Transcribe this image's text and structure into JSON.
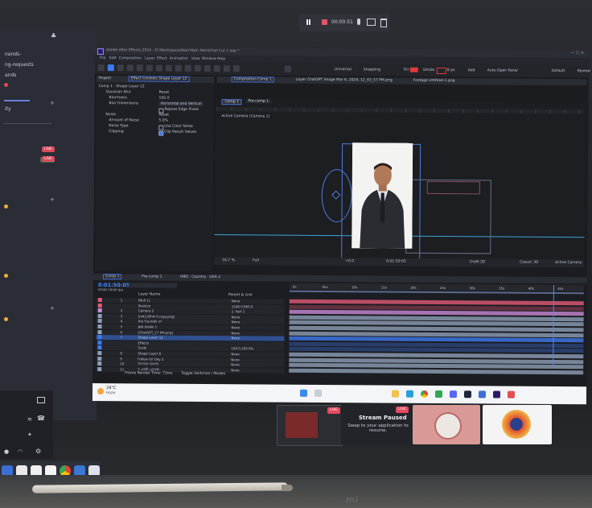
{
  "recording": {
    "time": "00:00:51"
  },
  "left_app": {
    "rows": [
      "nands-",
      "ng-requests",
      "ands",
      "ity"
    ],
    "live_label": "LIVE",
    "count_label": "23+23"
  },
  "ae": {
    "window_title": "Adobe After Effects 2024 - D:\\Workspace\\Reel Main Item\\Final Cut 1.aep *",
    "menu": [
      "File",
      "Edit",
      "Composition",
      "Layer",
      "Effect",
      "Animation",
      "View",
      "Window",
      "Help"
    ],
    "toolbar_options": [
      "Universal",
      "Snapping",
      "Fill",
      "Stroke",
      "8 px",
      "Add",
      "Auto-Open Panel",
      "Default",
      "Review"
    ],
    "project_tab": "Project",
    "effect_controls_tab": "Effect Controls Shape Layer 12",
    "effect_header": "Comp 1 · Shape Layer 12",
    "effects": [
      {
        "name": "Gaussian Blur",
        "value": "Reset"
      },
      {
        "name": "Blurriness",
        "value": "100.0"
      },
      {
        "name": "Blur Dimensions",
        "value": "Horizontal and Vertical"
      },
      {
        "name": "",
        "value": "Repeat Edge Pixels"
      },
      {
        "name": "Noise",
        "value": "Reset"
      },
      {
        "name": "Amount of Noise",
        "value": "5.0%"
      },
      {
        "name": "Noise Type",
        "value": "Use Color Noise"
      },
      {
        "name": "Clipping",
        "value": "Clip Result Values"
      }
    ],
    "composition_tab": "Composition Comp 1",
    "layer_tab": "Layer ChatGPT Image Mar 6, 2024, 12_43_57 PM.png",
    "footage_tab": "Footage Untitled-1.png",
    "viewer_tabs": [
      "Comp 1",
      "Pre-comp 1"
    ],
    "active_camera": "Active Camera (Camera 1)",
    "viewer_bottom": [
      "16.7 %",
      "Full",
      "+0.0",
      "0:01:50:05",
      "Draft 3D",
      "Classic 3D",
      "Active Camera"
    ],
    "timeline_tabs": [
      "Comp 1",
      "Pre-comp 1",
      "HBO · Country · USA 2"
    ],
    "timecode": "0:01:50:05",
    "frame_info": "03365 (30.00 fps)",
    "time_marks": [
      "0s",
      "05s",
      "10s",
      "15s",
      "20s",
      "25s",
      "30s",
      "35s",
      "40s",
      "45s"
    ],
    "col_headers": [
      "Layer Name",
      "Parent & Link"
    ],
    "layers": [
      {
        "num": "1",
        "name": "[Null 1]",
        "parent": "None",
        "color": "#e35a78"
      },
      {
        "num": "",
        "name": "Position",
        "parent": "1248.0,960.0",
        "color": "#e35a78"
      },
      {
        "num": "2",
        "name": "Camera 2",
        "parent": "1. Null 1",
        "color": "#c98ad8"
      },
      {
        "num": "3",
        "name": "[m4120h4-3-copy.png]",
        "parent": "None",
        "color": "#8fa0b8"
      },
      {
        "num": "4",
        "name": "the Founder of",
        "parent": "None",
        "color": "#8fa0b8"
      },
      {
        "num": "5",
        "name": "JAN KHAN 3",
        "parent": "None",
        "color": "#8fa0b8"
      },
      {
        "num": "6",
        "name": "[ChatGPT_17 PM.png]",
        "parent": "None",
        "color": "#8fa0b8"
      },
      {
        "num": "7",
        "name": "Shape Layer 12",
        "parent": "None",
        "color": "#3e7bf0"
      },
      {
        "num": "",
        "name": "Effects",
        "parent": "",
        "color": "#3e7bf0"
      },
      {
        "num": "",
        "name": "Scale",
        "parent": "100.0,100.0%",
        "color": "#3e7bf0"
      },
      {
        "num": "8",
        "name": "Shape Layer 8",
        "parent": "None",
        "color": "#8fa0b8"
      },
      {
        "num": "9",
        "name": "Follow for Day 2",
        "parent": "None",
        "color": "#8fa0b8"
      },
      {
        "num": "10",
        "name": "আপনার ব্যবসার",
        "parent": "None",
        "color": "#8fa0b8"
      },
      {
        "num": "11",
        "name": "T একটি প্রোডাক্ট",
        "parent": "None",
        "color": "#8fa0b8"
      }
    ],
    "footer": [
      "Frame Render Time: 73ms",
      "Toggle Switches / Modes"
    ]
  },
  "taskbar": {
    "temp": "28°C",
    "weather": "Haze"
  },
  "stream": {
    "paused_title": "Stream Paused",
    "paused_sub": "Swap to your application to resume.",
    "live_label": "LIVE"
  },
  "brand": {
    "monitor": "mi"
  },
  "colors": {
    "accent": "#3e7bf0",
    "live": "#e8485e",
    "pink_tile": "#d99a97"
  }
}
